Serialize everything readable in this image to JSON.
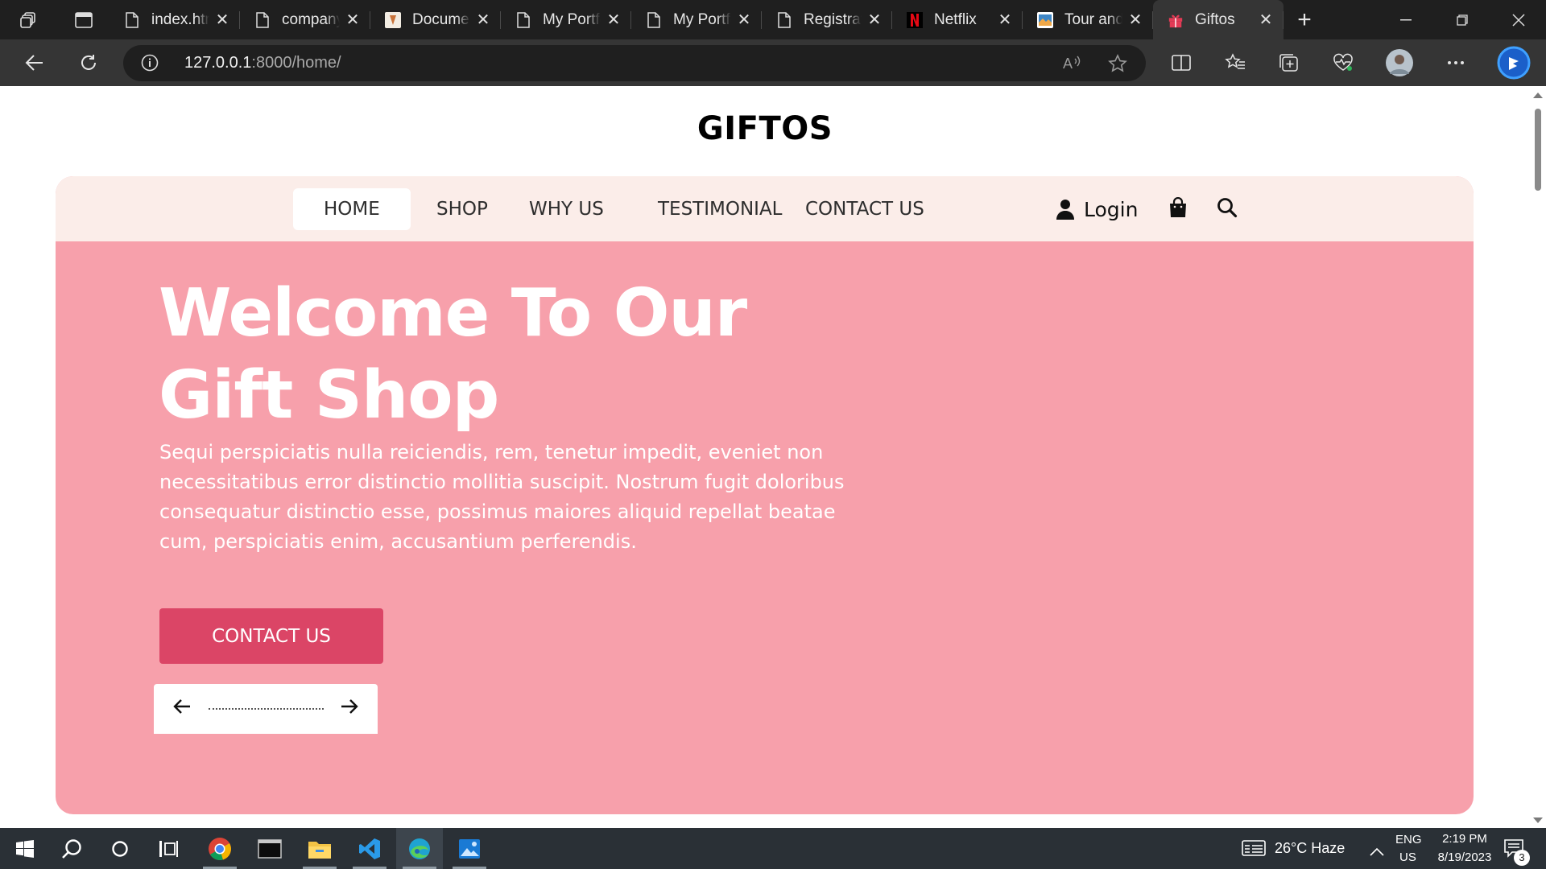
{
  "browser": {
    "tabs": [
      {
        "title": "index.html",
        "favicon": "file-icon"
      },
      {
        "title": "company",
        "favicon": "file-icon"
      },
      {
        "title": "Document",
        "favicon": "doc-image-icon"
      },
      {
        "title": "My Portfolio",
        "favicon": "file-icon"
      },
      {
        "title": "My Portfolio",
        "favicon": "file-icon"
      },
      {
        "title": "Registration",
        "favicon": "file-icon"
      },
      {
        "title": "Netflix",
        "favicon": "netflix-icon"
      },
      {
        "title": "Tour and",
        "favicon": "tour-icon"
      },
      {
        "title": "Giftos",
        "favicon": "gift-icon",
        "active": true
      }
    ],
    "url_host": "127.0.0.1",
    "url_path": ":8000/home/"
  },
  "page": {
    "brand": "GIFTOS",
    "nav": {
      "home": "HOME",
      "shop": "SHOP",
      "why_us": "WHY US",
      "testimonial": "TESTIMONIAL",
      "contact": "CONTACT US",
      "login": "Login"
    },
    "hero": {
      "title_line1": "Welcome To Our",
      "title_line2": "Gift Shop",
      "text": "Sequi perspiciatis nulla reiciendis, rem, tenetur impedit, eveniet non necessitatibus error distinctio mollitia suscipit. Nostrum fugit doloribus consequatur distinctio esse, possimus maiores aliquid repellat beatae cum, perspiciatis enim, accusantium perferendis.",
      "button": "CONTACT US"
    },
    "colors": {
      "hero_bg": "#f7a0ab",
      "nav_bg": "#fbede9",
      "button": "#db4566"
    }
  },
  "taskbar": {
    "weather": "26°C  Haze",
    "lang_top": "ENG",
    "lang_bottom": "US",
    "time": "2:19 PM",
    "date": "8/19/2023",
    "notifications": "3"
  }
}
